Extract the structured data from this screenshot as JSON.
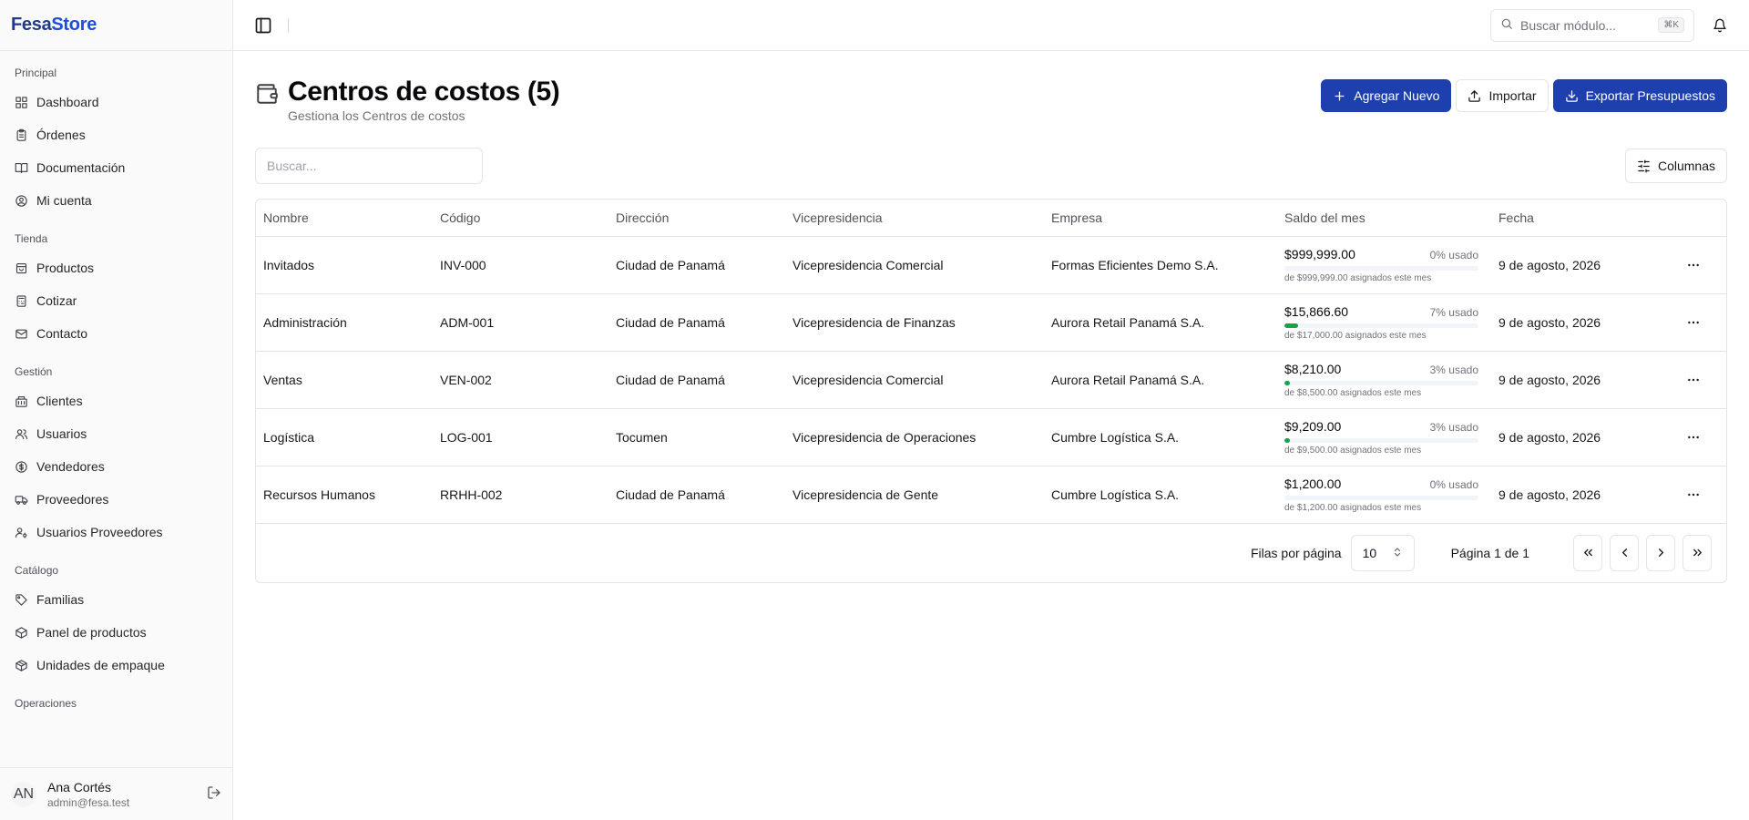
{
  "brand": {
    "part1": "Fesa",
    "part2": "Store"
  },
  "sidebar": {
    "sections": [
      {
        "title": "Principal",
        "items": [
          "Dashboard",
          "Órdenes",
          "Documentación",
          "Mi cuenta"
        ]
      },
      {
        "title": "Tienda",
        "items": [
          "Productos",
          "Cotizar",
          "Contacto"
        ]
      },
      {
        "title": "Gestión",
        "items": [
          "Clientes",
          "Usuarios",
          "Vendedores",
          "Proveedores",
          "Usuarios Proveedores"
        ]
      },
      {
        "title": "Catálogo",
        "items": [
          "Familias",
          "Panel de productos",
          "Unidades de empaque"
        ]
      },
      {
        "title": "Operaciones",
        "items": []
      }
    ],
    "user": {
      "initials": "AN",
      "name": "Ana Cortés",
      "email": "admin@fesa.test"
    }
  },
  "topbar": {
    "search_placeholder": "Buscar módulo...",
    "shortcut": "⌘K"
  },
  "page": {
    "title": "Centros de costos (5)",
    "subtitle": "Gestiona los Centros de costos",
    "actions": {
      "add": "Agregar Nuevo",
      "import": "Importar",
      "export": "Exportar Presupuestos"
    },
    "filter_placeholder": "Buscar...",
    "columns_button": "Columnas"
  },
  "table": {
    "headers": [
      "Nombre",
      "Código",
      "Dirección",
      "Vicepresidencia",
      "Empresa",
      "Saldo del mes",
      "Fecha"
    ],
    "rows": [
      {
        "nombre": "Invitados",
        "codigo": "INV-000",
        "direccion": "Ciudad de Panamá",
        "vice": "Vicepresidencia Comercial",
        "empresa": "Formas Eficientes Demo S.A.",
        "saldo": "$999,999.00",
        "pct_label": "0% usado",
        "pct": 0,
        "sub": "de $999,999.00 asignados este mes",
        "fecha": "9 de agosto, 2026"
      },
      {
        "nombre": "Administración",
        "codigo": "ADM-001",
        "direccion": "Ciudad de Panamá",
        "vice": "Vicepresidencia de Finanzas",
        "empresa": "Aurora Retail Panamá S.A.",
        "saldo": "$15,866.60",
        "pct_label": "7% usado",
        "pct": 7,
        "sub": "de $17,000.00 asignados este mes",
        "fecha": "9 de agosto, 2026"
      },
      {
        "nombre": "Ventas",
        "codigo": "VEN-002",
        "direccion": "Ciudad de Panamá",
        "vice": "Vicepresidencia Comercial",
        "empresa": "Aurora Retail Panamá S.A.",
        "saldo": "$8,210.00",
        "pct_label": "3% usado",
        "pct": 3,
        "sub": "de $8,500.00 asignados este mes",
        "fecha": "9 de agosto, 2026"
      },
      {
        "nombre": "Logística",
        "codigo": "LOG-001",
        "direccion": "Tocumen",
        "vice": "Vicepresidencia de Operaciones",
        "empresa": "Cumbre Logística S.A.",
        "saldo": "$9,209.00",
        "pct_label": "3% usado",
        "pct": 3,
        "sub": "de $9,500.00 asignados este mes",
        "fecha": "9 de agosto, 2026"
      },
      {
        "nombre": "Recursos Humanos",
        "codigo": "RRHH-002",
        "direccion": "Ciudad de Panamá",
        "vice": "Vicepresidencia de Gente",
        "empresa": "Cumbre Logística S.A.",
        "saldo": "$1,200.00",
        "pct_label": "0% usado",
        "pct": 0,
        "sub": "de $1,200.00 asignados este mes",
        "fecha": "9 de agosto, 2026"
      }
    ]
  },
  "pagination": {
    "rows_label": "Filas por página",
    "rows_value": "10",
    "page_info": "Página 1 de 1"
  },
  "colors": {
    "primary": "#1e40af",
    "progress": "#16a34a"
  }
}
